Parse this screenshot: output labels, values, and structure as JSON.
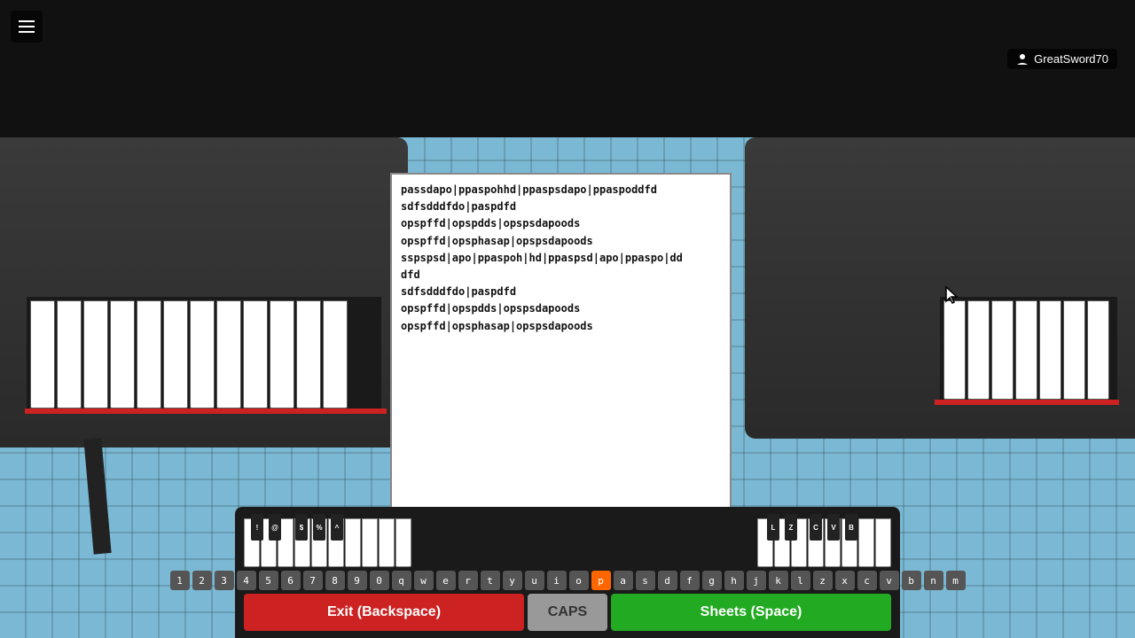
{
  "game": {
    "username": "GreatSword70",
    "bgColor": "#7ab8d4"
  },
  "sheet": {
    "content": [
      "passdapo|ppaspohhd|ppaspsdapo|ppaspoddfd",
      "sdfsdddfdo|paspdfd",
      "opspffd|opspdds|opspsdapoods",
      "opspffd|opsphasap|opspsdapoods",
      "sspspsd|apo|ppaspoh|hd|ppaspsd|apo|ppaspo|dd",
      "dfd",
      "sdfsdddfdo|paspdfd",
      "opspffd|opspdds|opspsdapoods",
      "opspffd|opsphasap|opspsdapoods"
    ]
  },
  "keyboard": {
    "special_keys_left": [
      "!",
      "@",
      "$",
      "%",
      "^"
    ],
    "special_keys_right": [
      "L",
      "Z",
      "C",
      "V",
      "B"
    ],
    "number_row": [
      "1",
      "2",
      "3",
      "4",
      "5",
      "6",
      "7",
      "8",
      "9",
      "0",
      "q",
      "w",
      "e",
      "r",
      "t",
      "y",
      "u",
      "i",
      "o",
      "p",
      "a",
      "s",
      "d",
      "f",
      "g",
      "h",
      "j",
      "k",
      "l",
      "z",
      "x",
      "c",
      "v",
      "b",
      "n",
      "m"
    ],
    "active_key": "p"
  },
  "buttons": {
    "exit_label": "Exit (Backspace)",
    "caps_label": "CAPS",
    "sheets_label": "Sheets (Space)"
  }
}
